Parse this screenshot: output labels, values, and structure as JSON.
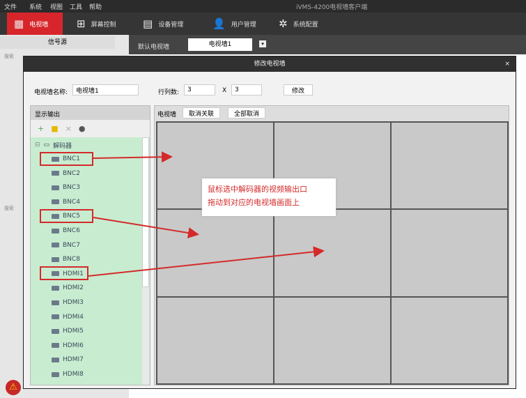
{
  "menu": [
    "文件",
    "系统",
    "视图",
    "工具",
    "帮助"
  ],
  "app_title": "iVMS-4200电视墙客户端",
  "toolbar": [
    {
      "label": "电视墙",
      "icon": "tv-wall-icon"
    },
    {
      "label": "屏幕控制",
      "icon": "screen-icon"
    },
    {
      "label": "设备管理",
      "icon": "device-icon"
    },
    {
      "label": "用户管理",
      "icon": "user-icon"
    },
    {
      "label": "系统配置",
      "icon": "gear-icon"
    }
  ],
  "left": {
    "source_label": "信号源",
    "search": "搜索"
  },
  "tabs": [
    "默认电视墙",
    "电视墙1"
  ],
  "dialog": {
    "title": "修改电视墙",
    "close": "×",
    "name_label": "电视墙名称:",
    "name_value": "电视墙1",
    "rows_label": "行列数:",
    "rows": "3",
    "x": "X",
    "cols": "3",
    "modify": "修改",
    "tree_header": "显示输出",
    "root": "解码器",
    "outputs": [
      "BNC1",
      "BNC2",
      "BNC3",
      "BNC4",
      "BNC5",
      "BNC6",
      "BNC7",
      "BNC8",
      "HDMI1",
      "HDMI2",
      "HDMI3",
      "HDMI4",
      "HDMI5",
      "HDMI6",
      "HDMI7",
      "HDMI8"
    ],
    "wall_label": "电视墙",
    "unlink": "取消关联",
    "cancel_all": "全部取消"
  },
  "annotation": [
    "鼠标选中解码器的视频输出口",
    "拖动到对应的电视墙画面上"
  ]
}
